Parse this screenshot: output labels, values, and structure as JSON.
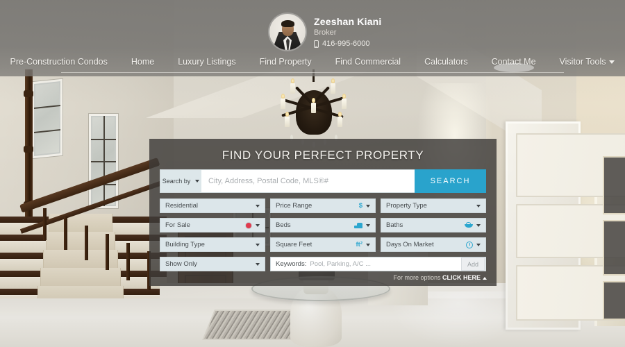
{
  "agent": {
    "name": "Zeeshan Kiani",
    "role": "Broker",
    "phone": "416-995-6000",
    "phone_icon": "mobile-phone-icon",
    "avatar_icon": "agent-avatar"
  },
  "nav": {
    "items": [
      {
        "label": "Pre-Construction Condos",
        "active": false
      },
      {
        "label": "Home",
        "active": false
      },
      {
        "label": "Luxury Listings",
        "active": false
      },
      {
        "label": "Find Property",
        "active": false
      },
      {
        "label": "Find Commercial",
        "active": false
      },
      {
        "label": "Calculators",
        "active": false
      },
      {
        "label": "Contact Me",
        "active": true
      },
      {
        "label": "Visitor Tools",
        "active": false,
        "caret": "chevron-down-icon"
      }
    ]
  },
  "search_panel": {
    "title": "FIND YOUR PERFECT PROPERTY",
    "search_by_label": "Search by",
    "query_value": "",
    "query_placeholder": "City, Address, Postal Code, MLS®#",
    "search_button": "SEARCH",
    "accent_color": "#29a3cc",
    "field_color": "#dce6ea",
    "panel_color": "#3e3c39",
    "filters": {
      "col1": [
        {
          "label": "Residential",
          "icon": null
        },
        {
          "label": "For Sale",
          "icon": "red-dot-icon",
          "icon_color": "#e03a4e"
        },
        {
          "label": "Building Type",
          "icon": null
        },
        {
          "label": "Show Only",
          "icon": null
        }
      ],
      "col2": [
        {
          "label": "Price Range",
          "icon": "dollar-icon",
          "icon_text": "$"
        },
        {
          "label": "Beds",
          "icon": "bed-icon"
        },
        {
          "label": "Square Feet",
          "icon": "square-feet-icon",
          "icon_text": "ft²"
        }
      ],
      "col3": [
        {
          "label": "Property Type",
          "icon": null
        },
        {
          "label": "Baths",
          "icon": "bathtub-icon"
        },
        {
          "label": "Days On Market",
          "icon": "clock-icon"
        }
      ]
    },
    "keywords": {
      "label": "Keywords:",
      "placeholder": "Pool, Parking, A/C ...",
      "value": "",
      "add_button": "Add"
    },
    "more_options": {
      "prefix": "For more options ",
      "link": "CLICK HERE",
      "caret": "caret-up-icon"
    }
  }
}
